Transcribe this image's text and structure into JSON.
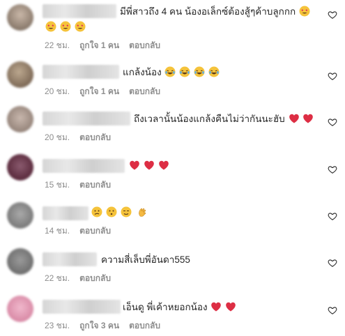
{
  "comments": [
    {
      "text": "มีพี่สาวถึง 4 คน น้องอเล็กซ์ต้องสู้ๆค้าบลูกกก",
      "inline_emojis": [
        "star-eyes"
      ],
      "extra_emojis": [
        "star-eyes",
        "star-eyes",
        "star-eyes"
      ],
      "time": "22 ชม.",
      "likes": "ถูกใจ 1 คน",
      "reply": "ตอบกลับ"
    },
    {
      "text": "แกล้งน้อง",
      "inline_emojis": [
        "laugh-tears",
        "laugh-tears",
        "laugh-tears",
        "laugh-tears"
      ],
      "time": "20 ชม.",
      "likes": "ถูกใจ 1 คน",
      "reply": "ตอบกลับ"
    },
    {
      "text": "ถึงเวลานั้นน้องแกล้งคืนไม่ว่ากันนะฮับ",
      "inline_emojis": [
        "red-heart",
        "red-heart"
      ],
      "time": "20 ชม.",
      "reply": "ตอบกลับ"
    },
    {
      "text": "",
      "inline_emojis": [
        "red-heart",
        "red-heart",
        "red-heart"
      ],
      "time": "15 ชม.",
      "reply": "ตอบกลับ"
    },
    {
      "text": "",
      "inline_emojis": [
        "confused-face",
        "hushed-face",
        "smirk-face",
        "clap-hands"
      ],
      "time": "14 ชม.",
      "reply": "ตอบกลับ"
    },
    {
      "text": "ความสี่เล็บพี่อันดา555",
      "inline_emojis": [],
      "time": "22 ชม.",
      "reply": "ตอบกลับ"
    },
    {
      "text": "เอ็นดู พี่เค้าหยอกน้อง",
      "inline_emojis": [
        "red-heart",
        "red-heart"
      ],
      "time": "23 ชม.",
      "likes": "ถูกใจ 3 คน",
      "reply": "ตอบกลับ"
    }
  ],
  "colors": {
    "meta_text": "#8e8e8e",
    "body_text": "#262626",
    "heart_outline": "#262626"
  }
}
